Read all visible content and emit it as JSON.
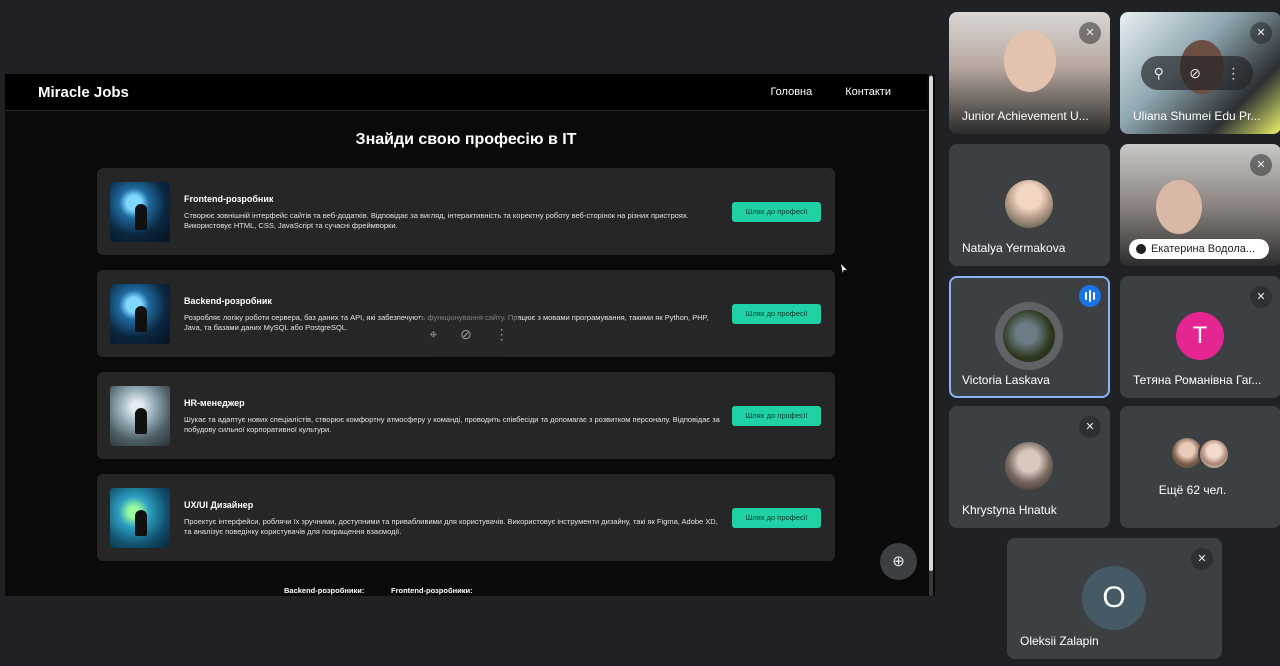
{
  "site": {
    "logo": "Miracle Jobs",
    "nav": [
      "Головна",
      "Контакти"
    ],
    "title": "Знайди свою професію в IT",
    "cards": [
      {
        "title": "Frontend-розробник",
        "desc": "Створює зовнішній інтерфейс сайтів та веб-додатків. Відповідає за вигляд, інтерактивність та коректну роботу веб-сторінок на різних пристроях. Використовує HTML, CSS, JavaScript та сучасні фреймворки.",
        "button": "Шлях до професії"
      },
      {
        "title": "Backend-розробник",
        "desc": "Розробляє логіку роботи сервера, баз даних та API, які забезпечують функціонування сайту. Працює з мовами програмування, такими як Python, PHP, Java, та базами даних MySQL або PostgreSQL.",
        "button": "Шлях до професії"
      },
      {
        "title": "HR-менеджер",
        "desc": "Шукає та адаптує нових спеціалістів, створює комфортну атмосферу у команді, проводить співбесіди та допомагає з розвитком персоналу. Відповідає за побудову сильної корпоративної культури.",
        "button": "Шлях до професії"
      },
      {
        "title": "UX/UI Дизайнер",
        "desc": "Проектує інтерфейси, роблячи їх зручними, доступними та привабливими для користувачів. Використовує інструменти дизайну, такі як Figma, Adobe XD, та аналізує поведінку користувачів для покращення взаємодії.",
        "button": "Шлях до професії"
      }
    ],
    "bottom_labels": [
      "Backend-розробники:",
      "Frontend-розробники:"
    ]
  },
  "participants": [
    {
      "name": "Junior Achievement U...",
      "type": "video"
    },
    {
      "name": "Uliana Shumei Edu Pr...",
      "type": "video"
    },
    {
      "name": "Natalya Yermakova",
      "type": "photo"
    },
    {
      "name": "Екатерина Водола...",
      "type": "video"
    },
    {
      "name": "Victoria Laskava",
      "type": "photo",
      "speaking": true
    },
    {
      "name": "Тетяна Романівна Гаг...",
      "type": "letter",
      "letter": "T",
      "color": "#e52592"
    },
    {
      "name": "Khrystyna Hnatuk",
      "type": "photo"
    },
    {
      "name": "Ещё 62 чел.",
      "type": "more"
    },
    {
      "name": "Oleksii Zalapin",
      "type": "letter",
      "letter": "O",
      "color": "#455a64"
    }
  ],
  "icons": {
    "mic_off": "mic-off-icon",
    "pin": "pin-icon",
    "more": "more-vert-icon",
    "zoom": "zoom-in-icon"
  }
}
